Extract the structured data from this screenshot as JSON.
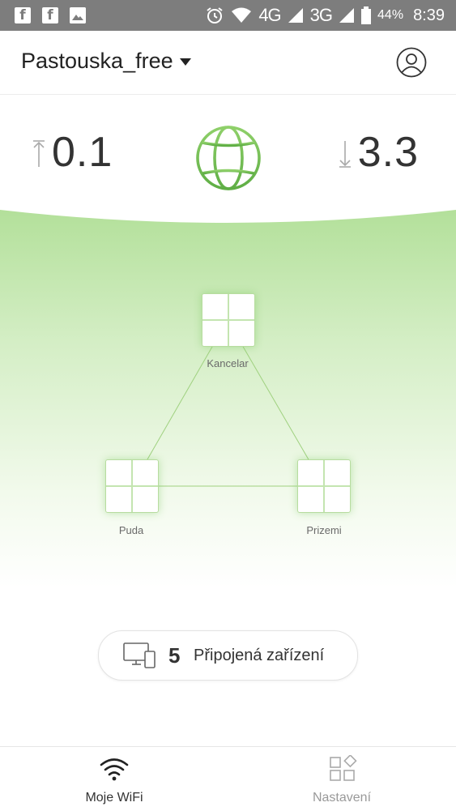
{
  "status_bar": {
    "left_icons": [
      "facebook-icon",
      "facebook-icon",
      "gallery-icon"
    ],
    "network_4g": "4G",
    "network_3g": "3G",
    "battery": "44%",
    "time": "8:39"
  },
  "header": {
    "network_name": "Pastouska_free"
  },
  "speed": {
    "upload": "0.1",
    "download": "3.3"
  },
  "nodes": [
    {
      "name": "Kancelar"
    },
    {
      "name": "Puda"
    },
    {
      "name": "Prizemi"
    }
  ],
  "devices": {
    "count": "5",
    "label": "Připojená zařízení"
  },
  "bottom_nav": {
    "wifi_label": "Moje WiFi",
    "settings_label": "Nastavení"
  },
  "colors": {
    "accent_green": "#7cc35a",
    "status_bar": "#7d7d7d"
  }
}
